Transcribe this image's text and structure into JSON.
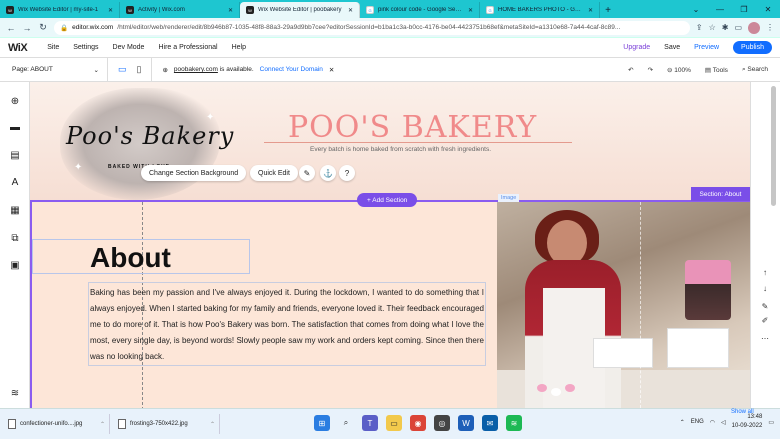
{
  "browser": {
    "tabs": [
      {
        "icon": "W",
        "title": "Wix Website Editor | my-site-1",
        "active": false
      },
      {
        "icon": "W",
        "title": "Activity | Wix.com",
        "active": false
      },
      {
        "icon": "W",
        "title": "Wix Website Editor | poobakery",
        "active": true
      },
      {
        "icon": "G",
        "title": "pink colour code - Google Search",
        "active": false
      },
      {
        "icon": "G",
        "title": "HOME BAKERS PHOTO - Google",
        "active": false
      }
    ],
    "url_host": "editor.wix.com",
    "url_path": "/html/editor/web/renderer/edit/8b946b87-1035-48f8-88a3-29a9d9bb7cee?editorSessionId=b1ba1c3a-b0cc-4176-be04-4423751b68ef&metaSiteId=a1310e68-7a44-4caf-8c89..."
  },
  "wix_topbar": {
    "logo": "WiX",
    "menu": [
      "Site",
      "Settings",
      "Dev Mode",
      "Hire a Professional",
      "Help"
    ],
    "upgrade": "Upgrade",
    "save": "Save",
    "preview": "Preview",
    "publish": "Publish"
  },
  "editor_bar": {
    "page_label": "Page: ABOUT",
    "domain_name": "poobakery.com",
    "domain_status": "is available.",
    "connect_label": "Connect Your Domain",
    "zoom": "100%",
    "tools_label": "Tools",
    "search_label": "Search"
  },
  "site": {
    "logo_text": "Poo's Bakery",
    "logo_sub": "BAKED WITH LOVE",
    "brand_title": "POO'S BAKERY",
    "tagline": "Every batch is home baked from scratch with fresh ingredients.",
    "header_actions": {
      "change_bg": "Change Section Background",
      "quick_edit": "Quick Edit",
      "help": "?"
    },
    "section_tag": "Section: About",
    "image_tag": "Image",
    "add_section": "+ Add Section",
    "about_title": "About",
    "about_text": "Baking has been my passion and I've always enjoyed it. During the lockdown, I wanted to do something that I always enjoyed. When I started baking for my family and friends, everyone loved it. Their feedback encouraged me to do more of it. That is how Poo's Bakery was born. The satisfaction that comes from doing what I love the most, every single day, is beyond words! Slowly people saw my work and orders kept coming. Since then there was no looking back."
  },
  "taskbar": {
    "downloads": [
      {
        "name": "confectioner-unifo....jpg"
      },
      {
        "name": "frosting3-750x422.jpg"
      }
    ],
    "show_all": "Show all",
    "lang": "ENG",
    "time": "13:48",
    "date": "10-09-2022"
  },
  "colors": {
    "accent_purple": "#7a4ee8",
    "wix_blue": "#116dff",
    "brand_pink": "#f08a8a",
    "canvas_bg": "#fde6d8"
  }
}
